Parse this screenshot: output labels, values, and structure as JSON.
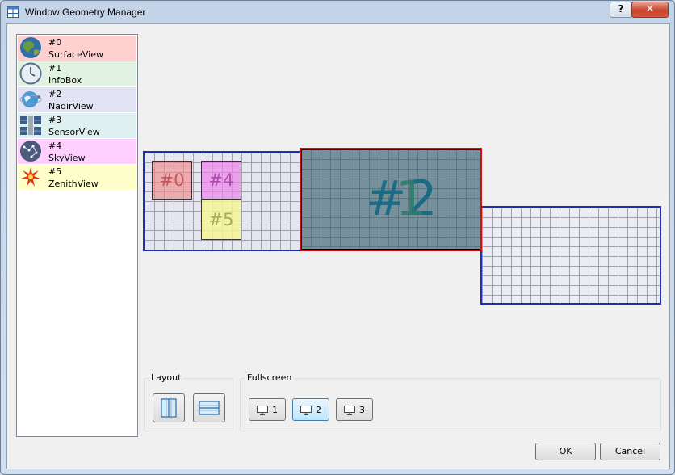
{
  "window": {
    "title": "Window Geometry Manager",
    "help_label": "?",
    "close_label": "✕"
  },
  "list": {
    "items": [
      {
        "num": "#0",
        "name": "SurfaceView",
        "bg": "#ffd0d0",
        "icon": "globe-icon"
      },
      {
        "num": "#1",
        "name": "InfoBox",
        "bg": "#e2f2e2",
        "icon": "clock-icon"
      },
      {
        "num": "#2",
        "name": "NadirView",
        "bg": "#e2e2f2",
        "icon": "earth-orbit-icon"
      },
      {
        "num": "#3",
        "name": "SensorView",
        "bg": "#dff0f0",
        "icon": "satellite-icon"
      },
      {
        "num": "#4",
        "name": "SkyView",
        "bg": "#ffd0ff",
        "icon": "constellation-icon"
      },
      {
        "num": "#5",
        "name": "ZenithView",
        "bg": "#ffffcc",
        "icon": "star-burst-icon"
      }
    ]
  },
  "canvas": {
    "windows": {
      "w0": "#0",
      "w4": "#4",
      "w5": "#5"
    },
    "big_a": "#2",
    "big_b": "1"
  },
  "layout": {
    "title": "Layout"
  },
  "fullscreen": {
    "title": "Fullscreen",
    "buttons": [
      "1",
      "2",
      "3"
    ],
    "selected": "2"
  },
  "dialog": {
    "ok": "OK",
    "cancel": "Cancel"
  }
}
